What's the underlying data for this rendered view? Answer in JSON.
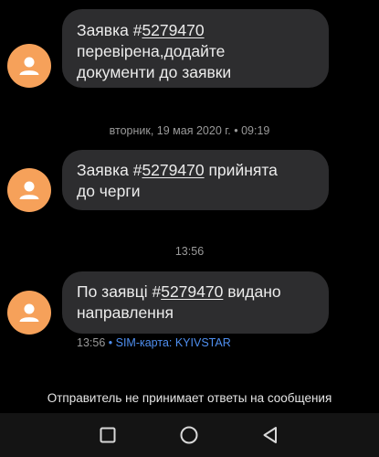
{
  "messages": [
    {
      "line1_prefix": "Заявка #",
      "line1_number": "5279470",
      "line2": "перевірена,додайте",
      "line3": "документи до заявки"
    },
    {
      "line1_prefix": "Заявка #",
      "line1_number": "5279470",
      "line1_suffix": " прийнята",
      "line2": "до черги"
    },
    {
      "line1_prefix": "По заявці #",
      "line1_number": "5279470",
      "line1_suffix": " видано",
      "line2": "направлення"
    }
  ],
  "timestamps": {
    "divider_1": "вторник, 19 мая 2020 г. • 09:19",
    "divider_2": "13:56"
  },
  "last_message_meta": {
    "time": "13:56",
    "sim_label": " • SIM-карта: KYIVSTAR"
  },
  "footer_note": "Отправитель не принимает ответы на сообщения",
  "colors": {
    "background": "#000000",
    "bubble": "#2d2d2f",
    "avatar": "#f6a15a",
    "sim_accent": "#4f8ff0",
    "muted_text": "#9a9a9a"
  },
  "icons": {
    "avatar": "person-icon",
    "nav_recent": "square-icon",
    "nav_home": "circle-icon",
    "nav_back": "triangle-back-icon"
  }
}
